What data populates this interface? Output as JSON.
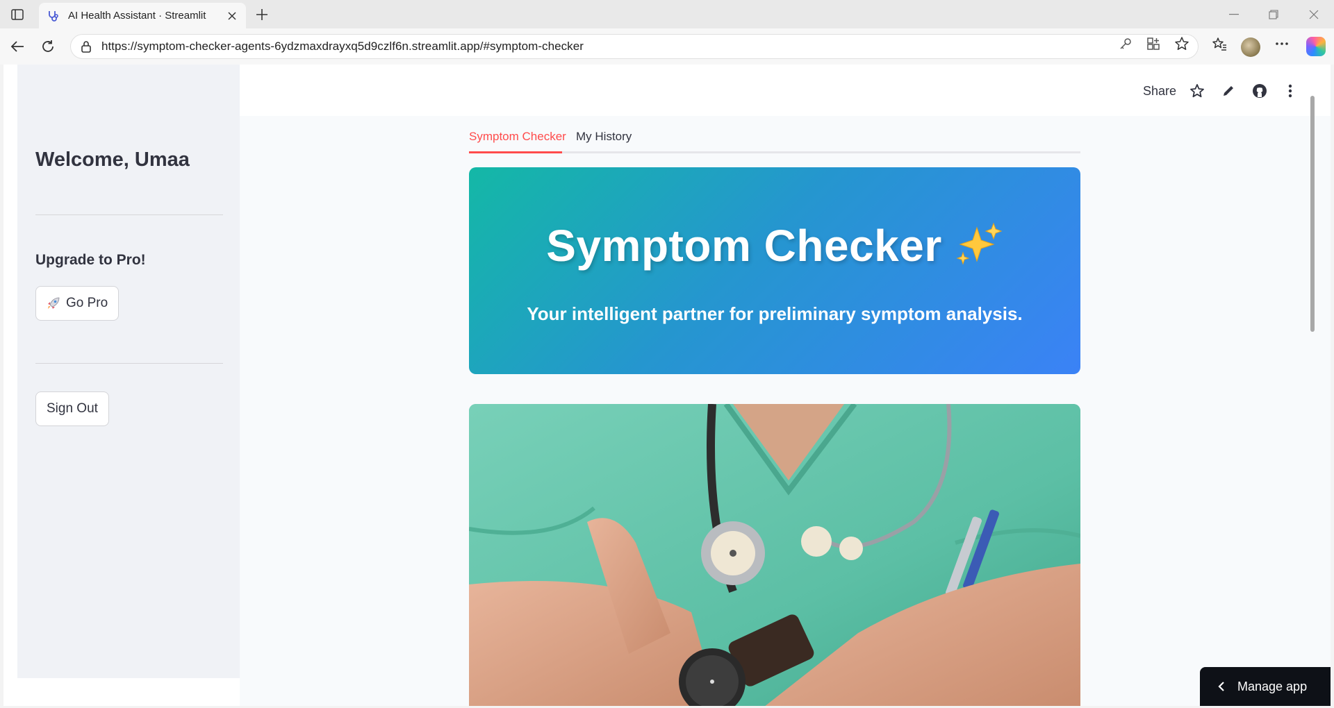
{
  "browser": {
    "tab_title": "AI Health Assistant · Streamlit",
    "url": "https://symptom-checker-agents-6ydzmaxdrayxq5d9czlf6n.streamlit.app/#symptom-checker"
  },
  "app": {
    "topbar": {
      "share_label": "Share"
    },
    "sidebar": {
      "welcome": "Welcome, Umaa",
      "upgrade_heading": "Upgrade to Pro!",
      "go_pro_label": "Go Pro",
      "sign_out_label": "Sign Out"
    },
    "tabs": [
      {
        "label": "Symptom Checker",
        "active": true
      },
      {
        "label": "My History",
        "active": false
      }
    ],
    "hero": {
      "title": "Symptom Checker",
      "subtitle": "Your intelligent partner for preliminary symptom analysis."
    },
    "manage_app_label": "Manage app"
  },
  "colors": {
    "accent": "#ff4b4b",
    "hero_gradient_start": "#14b8a6",
    "hero_gradient_end": "#3b82f6",
    "sidebar_bg": "#f0f2f6"
  }
}
